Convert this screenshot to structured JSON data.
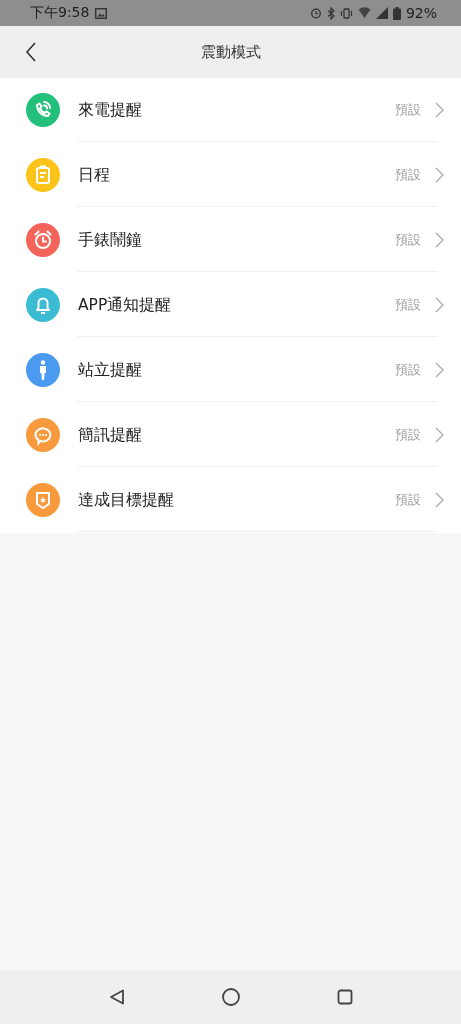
{
  "status_bar": {
    "time": "下午9:58",
    "battery": "92%"
  },
  "header": {
    "title": "震動模式"
  },
  "items": [
    {
      "label": "來電提醒",
      "value": "預設",
      "color": "#22c07a"
    },
    {
      "label": "日程",
      "value": "預設",
      "color": "#fcc419"
    },
    {
      "label": "手錶鬧鐘",
      "value": "預設",
      "color": "#f4645a"
    },
    {
      "label": "APP通知提醒",
      "value": "預設",
      "color": "#3cbcd2"
    },
    {
      "label": "站立提醒",
      "value": "預設",
      "color": "#4a9af0"
    },
    {
      "label": "簡訊提醒",
      "value": "預設",
      "color": "#f7993c"
    },
    {
      "label": "達成目標提醒",
      "value": "預設",
      "color": "#f7993c"
    }
  ]
}
